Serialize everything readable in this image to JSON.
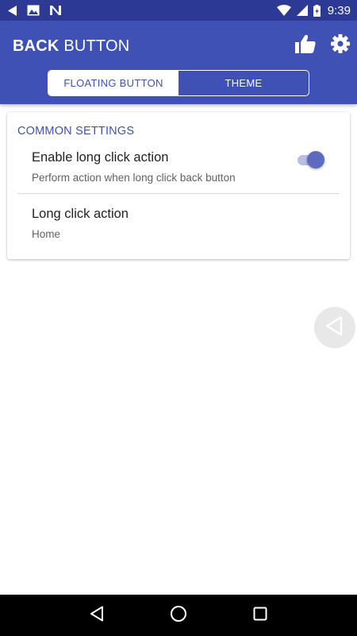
{
  "status_bar": {
    "time": "9:39",
    "left_icons": [
      "back-arrow-icon",
      "image-icon",
      "n-notification-icon"
    ],
    "right_icons": [
      "wifi-icon",
      "cell-signal-icon",
      "battery-icon"
    ]
  },
  "app_bar": {
    "title_bold": "BACK",
    "title_light": " BUTTON",
    "actions": [
      "thumbs-up-icon",
      "gear-icon"
    ],
    "background_color": "#3f51b5"
  },
  "tabs": [
    {
      "label": "FLOATING BUTTON",
      "active": true
    },
    {
      "label": "THEME",
      "active": false
    }
  ],
  "settings": {
    "section_title": "COMMON SETTINGS",
    "items": [
      {
        "title": "Enable long click action",
        "summary": "Perform action when long click back button",
        "switch_on": true
      },
      {
        "title": "Long click action",
        "summary": "Home"
      }
    ]
  },
  "floating_button": {
    "icon": "back-triangle-icon"
  },
  "nav_bar": {
    "buttons": [
      "back-icon",
      "home-icon",
      "recents-icon"
    ]
  },
  "colors": {
    "primary": "#3f51b5",
    "primary_dark": "#2c3a96",
    "accent": "#5c6bc0"
  }
}
